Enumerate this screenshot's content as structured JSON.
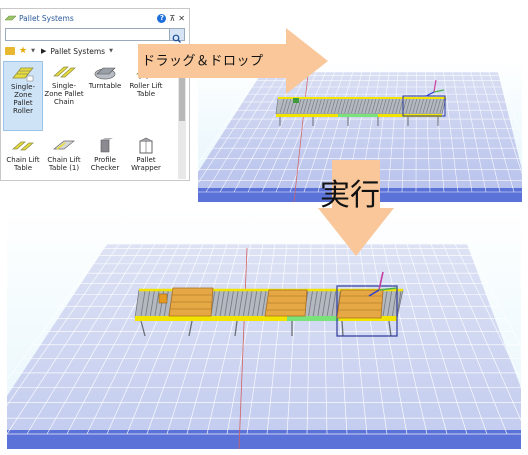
{
  "panel": {
    "title": "Pallet Systems",
    "search_value": "",
    "breadcrumb": "Pallet Systems",
    "items": [
      {
        "label": "Single-Zone Pallet Roller",
        "icon": "single-zone-pallet-roller-icon",
        "selected": true
      },
      {
        "label": "Single-Zone Pallet Chain",
        "icon": "single-zone-pallet-chain-icon",
        "selected": false
      },
      {
        "label": "Turntable",
        "icon": "turntable-icon",
        "selected": false
      },
      {
        "label": "Roller Lift Table",
        "icon": "roller-lift-table-icon",
        "selected": false
      },
      {
        "label": "Chain Lift Table",
        "icon": "chain-lift-table-icon",
        "selected": false
      },
      {
        "label": "Chain Lift Table (1)",
        "icon": "chain-lift-table-1-icon",
        "selected": false
      },
      {
        "label": "Profile Checker",
        "icon": "profile-checker-icon",
        "selected": false
      },
      {
        "label": "Pallet Wrapper",
        "icon": "pallet-wrapper-icon",
        "selected": false
      }
    ]
  },
  "annotations": {
    "drag_drop": "ドラッグ＆ドロップ",
    "run": "実行"
  },
  "colors": {
    "arrow": "#f9c79a",
    "floor_top": "#cfd5f0",
    "floor_bottom": "#5a74d8",
    "frame": "#f2e600",
    "pallet": "#e7b050",
    "rollers": "#9aa0a8",
    "sky": "#eaf7ff"
  }
}
